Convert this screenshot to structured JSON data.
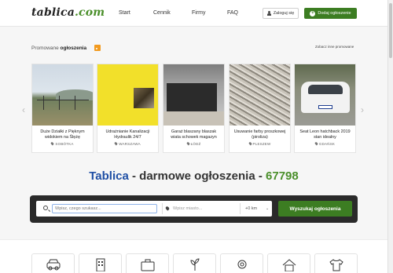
{
  "header": {
    "logo_text": "tablica",
    "logo_suffix": ".com",
    "nav": [
      "Start",
      "Cennik",
      "Firmy",
      "FAQ"
    ],
    "login_label": "Zaloguj się",
    "add_label": "Dodaj ogłoszenie"
  },
  "promoted": {
    "title_prefix": "Promowane",
    "title_main": "ogłoszenia",
    "link": "Zobacz inne promowane",
    "items": [
      {
        "title": "Duże Działki z Pięknym widokiem na Ślężę",
        "location": "SOBÓTKA"
      },
      {
        "title": "Udrażnianie Kanalizacji Hydraulik 24/7",
        "location": "WARSZAWA"
      },
      {
        "title": "Garaż blaszany blaszak wiata schowek magazyn",
        "location": "ŁÓDŹ"
      },
      {
        "title": "Usuwanie farby proszkowej (piroliza)",
        "location": "PLESZEW"
      },
      {
        "title": "Seat Leon hatchback 2019 stan idealny",
        "location": "GDAŃSK"
      }
    ]
  },
  "hero": {
    "brand": "Tablica",
    "middle": " - darmowe ogłoszenia - ",
    "count": "67798"
  },
  "search": {
    "query_placeholder": "Wpisz, czego szukasz...",
    "location_placeholder": "Wpisz miasto...",
    "radius": "+0 km",
    "button_label": "Wyszukaj ogłoszenia"
  },
  "colors": {
    "accent_green": "#3c7d22",
    "brand_blue": "#1f4fa5",
    "count_green": "#4a8f2a"
  }
}
